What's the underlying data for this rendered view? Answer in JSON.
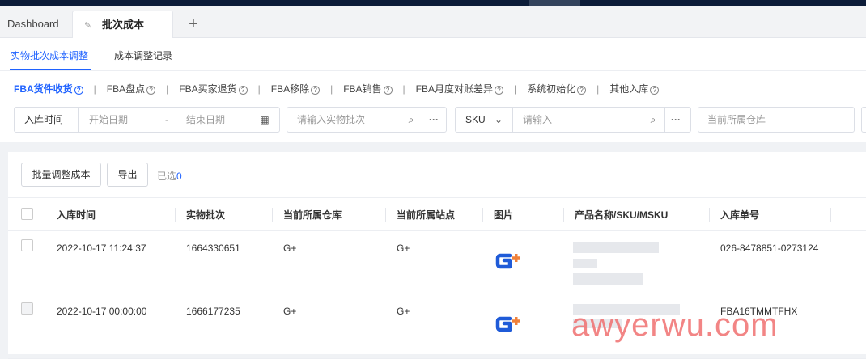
{
  "tabs": {
    "dashboard": "Dashboard",
    "active": "批次成本",
    "pin_icon": "pin-icon",
    "add": "+"
  },
  "subtabs": {
    "adjust": "实物批次成本调整",
    "records": "成本调整记录"
  },
  "types": [
    {
      "label": "FBA货件收货",
      "active": true
    },
    {
      "label": "FBA盘点"
    },
    {
      "label": "FBA买家退货"
    },
    {
      "label": "FBA移除"
    },
    {
      "label": "FBA销售"
    },
    {
      "label": "FBA月度对账差异"
    },
    {
      "label": "系统初始化"
    },
    {
      "label": "其他入库"
    }
  ],
  "filters": {
    "date_label": "入库时间",
    "start_placeholder": "开始日期",
    "dash": "-",
    "end_placeholder": "结束日期",
    "batch_placeholder": "请输入实物批次",
    "sku_select": "SKU",
    "sku_placeholder": "请输入",
    "warehouse_placeholder": "当前所属仓库",
    "more": "···"
  },
  "toolbar": {
    "batch_adjust": "批量调整成本",
    "export": "导出",
    "selected_label": "已选",
    "selected_count": "0"
  },
  "columns": [
    "入库时间",
    "实物批次",
    "当前所属仓库",
    "当前所属站点",
    "图片",
    "产品名称/SKU/MSKU",
    "入库单号"
  ],
  "rows": [
    {
      "time": "2022-10-17 11:24:37",
      "batch": "1664330651",
      "warehouse": "G+",
      "site": "G+",
      "order": "026-8478851-0273124"
    },
    {
      "time": "2022-10-17 00:00:00",
      "batch": "1666177235",
      "warehouse": "G+",
      "site": "G+",
      "order": "FBA16TMMTFHX"
    }
  ],
  "watermark": "awyerwu.com",
  "colors": {
    "accent": "#1f62ff",
    "logo_blue": "#1f5bd8",
    "logo_orange": "#f0813a"
  }
}
